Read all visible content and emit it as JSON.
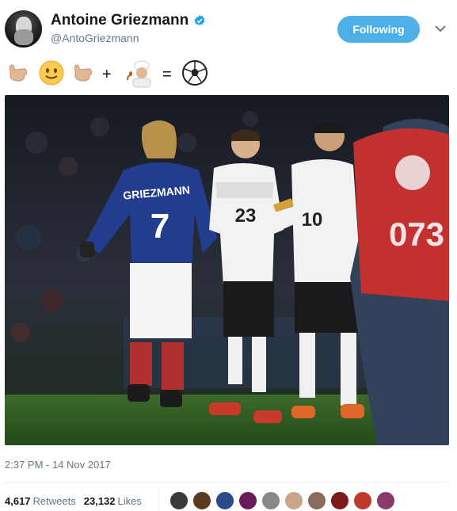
{
  "tweet": {
    "display_name": "Antoine Griezmann",
    "handle": "@AntoGriezmann",
    "follow_label": "Following",
    "emoji_text": [
      "🤙🏼",
      "🙂",
      "🤙🏼",
      "+",
      "🧑🏼‍🍳",
      "=",
      "⚽"
    ],
    "timestamp": "2:37 PM - 14 Nov 2017",
    "retweets_count": "4,617",
    "retweets_label": "Retweets",
    "likes_count": "23,132",
    "likes_label": "Likes",
    "photo": {
      "jersey_left_name": "GRIEZMANN",
      "jersey_left_number": "7",
      "jersey_mid_number": "23",
      "jersey_right_number": "10",
      "vest_number": "073"
    }
  },
  "colors": {
    "follow_button": "#4fb0e8",
    "verified_badge": "#1da1f2",
    "france_blue": "#233d8e",
    "germany_white": "#f2f2f2",
    "pitch_green": "#2f5d22"
  },
  "likers": [
    {
      "color": "#3a3a3a"
    },
    {
      "color": "#5c3a1e"
    },
    {
      "color": "#2a4a8a"
    },
    {
      "color": "#6a1a5a"
    },
    {
      "color": "#888888"
    },
    {
      "color": "#c9a58a"
    },
    {
      "color": "#8a6a5a"
    },
    {
      "color": "#7a1a1a"
    },
    {
      "color": "#c0392b"
    },
    {
      "color": "#8a3a6a"
    }
  ]
}
